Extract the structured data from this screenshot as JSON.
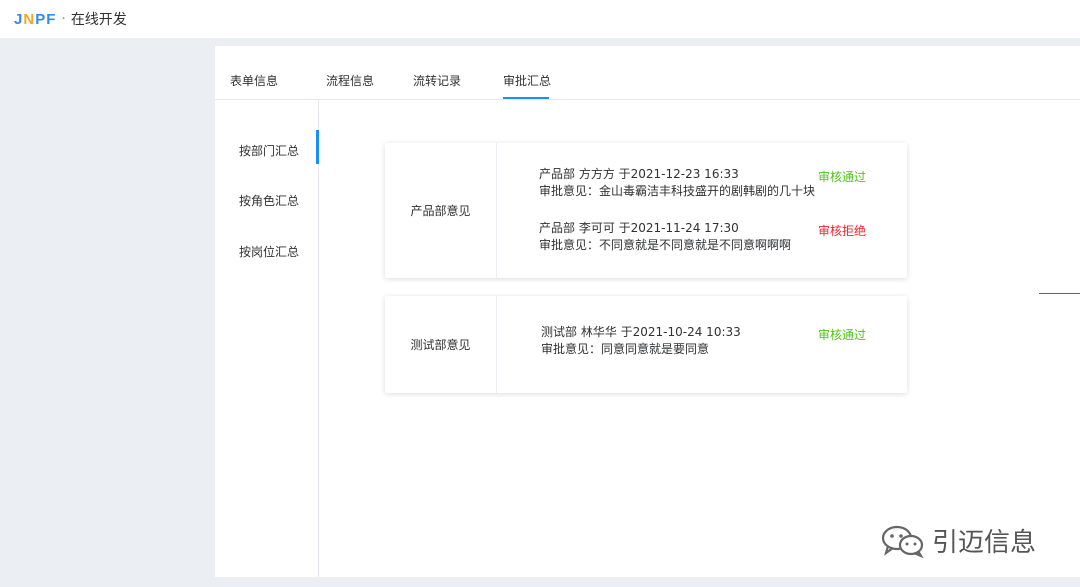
{
  "header": {
    "logo": {
      "j": "J",
      "n": "N",
      "pf": "PF"
    },
    "separator": "·",
    "title": "在线开发"
  },
  "tabs": [
    {
      "label": "表单信息"
    },
    {
      "label": "流程信息"
    },
    {
      "label": "流转记录"
    },
    {
      "label": "审批汇总",
      "active": true
    }
  ],
  "sidebar": {
    "items": [
      {
        "label": "按部门汇总",
        "active": true
      },
      {
        "label": "按角色汇总"
      },
      {
        "label": "按岗位汇总"
      }
    ]
  },
  "summary": {
    "groups": [
      {
        "dept_label": "产品部意见",
        "entries": [
          {
            "line1": "产品部  方方方 于2021-12-23 16:33",
            "line2": "审批意见：金山毒霸洁丰科技盛开的剧韩剧的几十块",
            "status": "审核通过"
          },
          {
            "line1": "产品部  李可可 于2021-11-24 17:30",
            "line2": "审批意见：不同意就是不同意就是不同意啊啊啊",
            "status": "审核拒绝"
          }
        ]
      },
      {
        "dept_label": "测试部意见",
        "entries": [
          {
            "line1": "测试部  林华华 于2021-10-24 10:33",
            "line2": "审批意见：同意同意就是要同意",
            "status": "审核通过"
          }
        ]
      }
    ]
  },
  "watermark": {
    "text": "引迈信息",
    "icon": "wechat-icon"
  },
  "colors": {
    "accent": "#1890ff",
    "approved": "#52c41a",
    "rejected": "#f5222d",
    "background": "#ebeef3"
  }
}
